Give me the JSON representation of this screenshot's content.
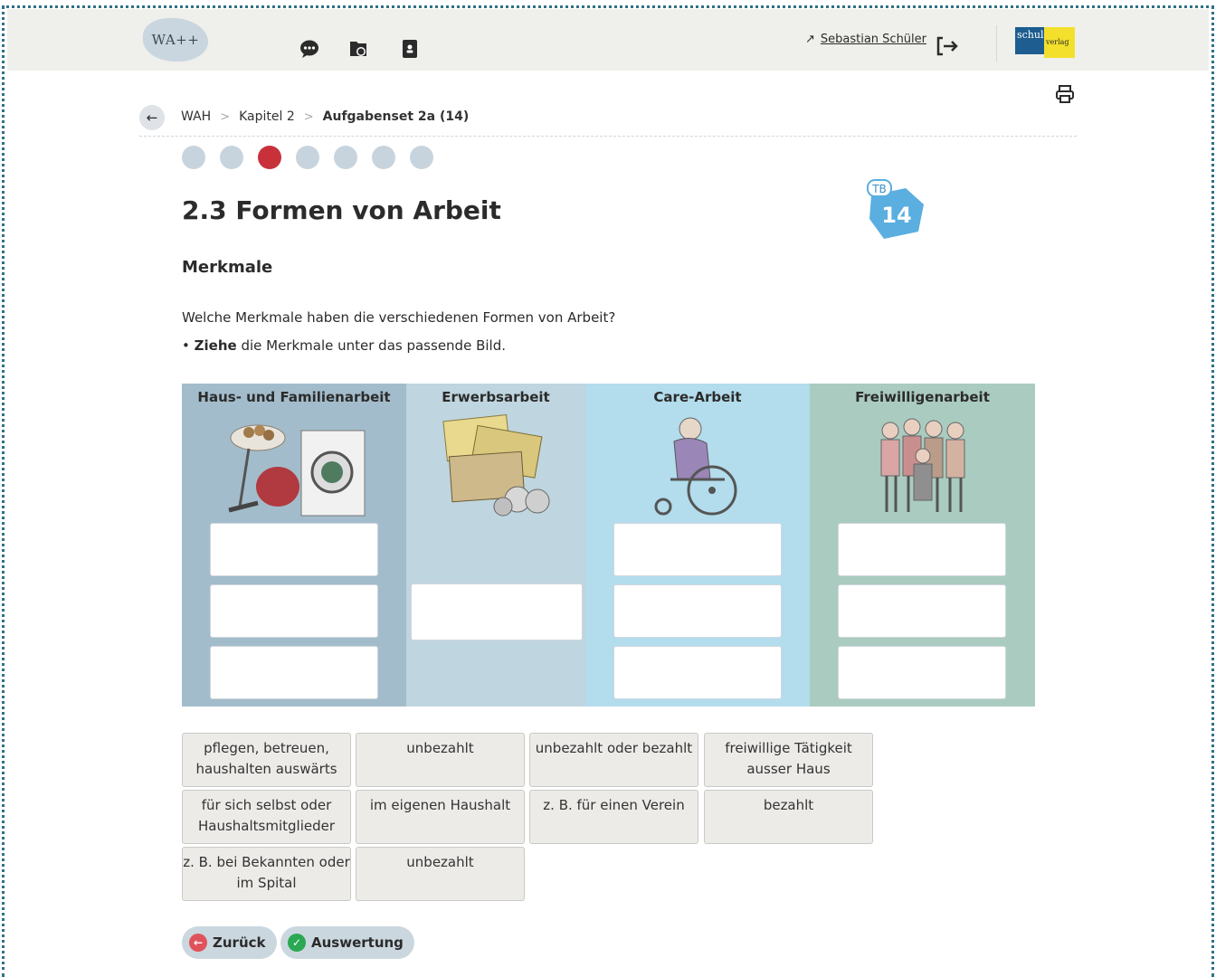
{
  "header": {
    "logo_text": "WA++",
    "user_arrow": "↗",
    "user_name": "Sebastian Schüler",
    "brand_left": "schul",
    "brand_right": "verlag"
  },
  "breadcrumb": {
    "items": [
      "WAH",
      "Kapitel 2",
      "Aufgabenset 2a (14)"
    ],
    "separator": ">"
  },
  "steps": {
    "count": 7,
    "active_index": 2
  },
  "page_title": "2.3 Formen von Arbeit",
  "badge": {
    "label": "TB",
    "number": "14"
  },
  "section_title": "Merkmale",
  "instruction": "Welche Merkmale haben die verschiedenen Formen von Arbeit?",
  "bullet": {
    "strong": "Ziehe",
    "rest": " die Merkmale unter das passende Bild."
  },
  "columns": [
    {
      "title": "Haus- und Familienarbeit",
      "slots": 3
    },
    {
      "title": "Erwerbsarbeit",
      "slots": 1
    },
    {
      "title": "Care-Arbeit",
      "slots": 3
    },
    {
      "title": "Freiwilligenarbeit",
      "slots": 3
    }
  ],
  "chips": [
    "pflegen, betreuen, haushalten auswärts",
    "unbezahlt",
    "unbezahlt oder bezahlt",
    "freiwillige Tätigkeit ausser Haus",
    "für sich selbst oder Haushaltsmitglieder",
    "im eigenen Haushalt",
    "z. B. für einen Verein",
    "bezahlt",
    "z. B. bei Bekannten oder im Spital",
    "unbezahlt"
  ],
  "buttons": {
    "back": "Zurück",
    "evaluate": "Auswertung"
  },
  "colors": {
    "accent_red": "#c8313a",
    "step_inactive": "#c8d4dd",
    "col1": "#a3bccb",
    "col2": "#bfd5df",
    "col3": "#b3dcec",
    "col4": "#aacbbf",
    "badge_blue": "#5aaee0",
    "ok_green": "#2aa853"
  },
  "icons": [
    "chat-icon",
    "folder-icon",
    "contacts-icon",
    "logout-icon",
    "print-icon",
    "back-arrow-icon"
  ]
}
